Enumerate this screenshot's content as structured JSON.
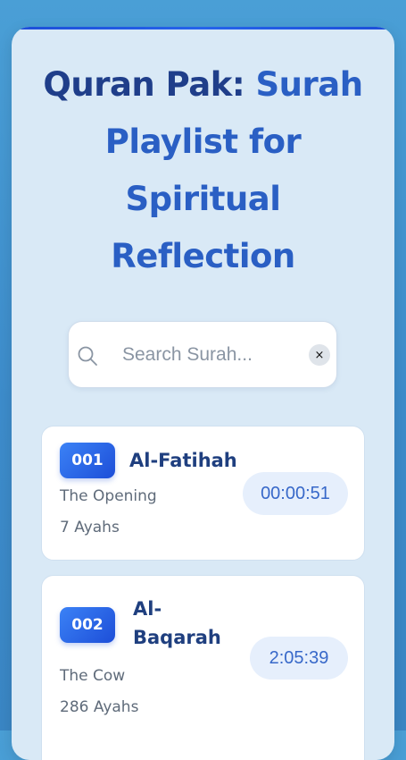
{
  "header": {
    "title_part1": "Quran Pak:",
    "title_part2": "Surah Playlist for Spiritual Reflection"
  },
  "search": {
    "placeholder": "Search Surah...",
    "value": "",
    "clear_label": "×"
  },
  "surahs": [
    {
      "number": "001",
      "name": "Al-Fatihah",
      "meaning": "The Opening",
      "ayahs": "7 Ayahs",
      "duration": "00:00:51"
    },
    {
      "number": "002",
      "name_line1": "Al-",
      "name_line2": "Baqarah",
      "meaning": "The Cow",
      "ayahs": "286 Ayahs",
      "duration": "2:05:39"
    }
  ],
  "colors": {
    "background": "#3d8ccb",
    "card": "#d9e9f6",
    "accent": "#1d4ed8",
    "title_dark": "#1f3e8a",
    "title_light": "#2a5fc4"
  }
}
